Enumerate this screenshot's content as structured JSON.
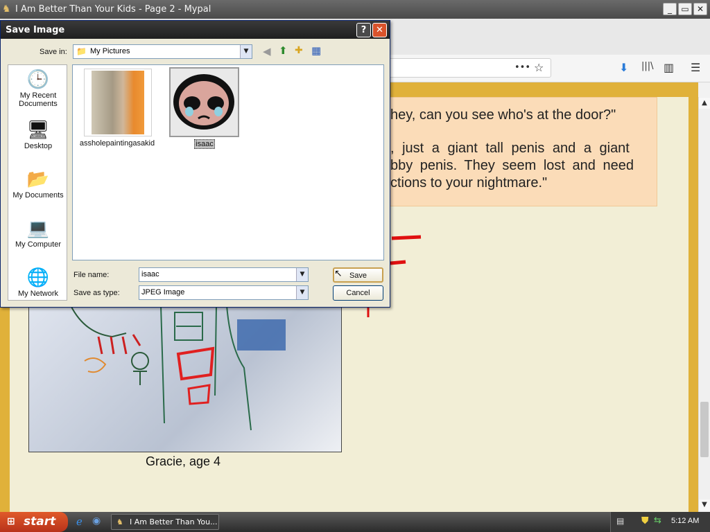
{
  "window": {
    "title": "I Am Better Than Your Kids - Page 2 - Mypal",
    "minimize": "_",
    "maximize": "▭",
    "close": "✕"
  },
  "navbar": {
    "more_icon": "•••",
    "bookmark_icon": "☆",
    "download_icon": "⬇",
    "library_icon": "|||\\",
    "sidebar_icon": "▥",
    "menu_icon": "☰"
  },
  "page": {
    "quote_lines": [
      "hey, can you see who's at the door?\"",
      ", just a giant tall penis and a giant",
      "bby penis. They seem lost and need",
      "ctions to your nightmare.\""
    ],
    "caption": "Gracie, age 4"
  },
  "dialog": {
    "title": "Save Image",
    "help": "?",
    "close": "✕",
    "save_in_label": "Save in:",
    "save_in_value": "My Pictures",
    "places": [
      {
        "label": "My Recent Documents",
        "icon": "recent-documents-icon",
        "glyph": "🕒"
      },
      {
        "label": "Desktop",
        "icon": "desktop-icon",
        "glyph": "🖥"
      },
      {
        "label": "My Documents",
        "icon": "my-documents-icon",
        "glyph": "📂"
      },
      {
        "label": "My Computer",
        "icon": "my-computer-icon",
        "glyph": "💻"
      },
      {
        "label": "My Network",
        "icon": "my-network-icon",
        "glyph": "🌐"
      }
    ],
    "files": [
      {
        "name": "assholepaintingasakid"
      },
      {
        "name": "isaac",
        "selected": true
      }
    ],
    "file_name_label": "File name:",
    "file_name_value": "isaac",
    "save_as_type_label": "Save as type:",
    "save_as_type_value": "JPEG Image",
    "save_button": "Save",
    "cancel_button": "Cancel"
  },
  "taskbar": {
    "start": "start",
    "task": "I Am Better Than You...",
    "clock": "5:12 AM"
  },
  "colors": {
    "page_border": "#e0b13a",
    "page_bg": "#f2eed6",
    "quote_bg": "#fbdcb8",
    "download_blue": "#2a7bd8"
  }
}
